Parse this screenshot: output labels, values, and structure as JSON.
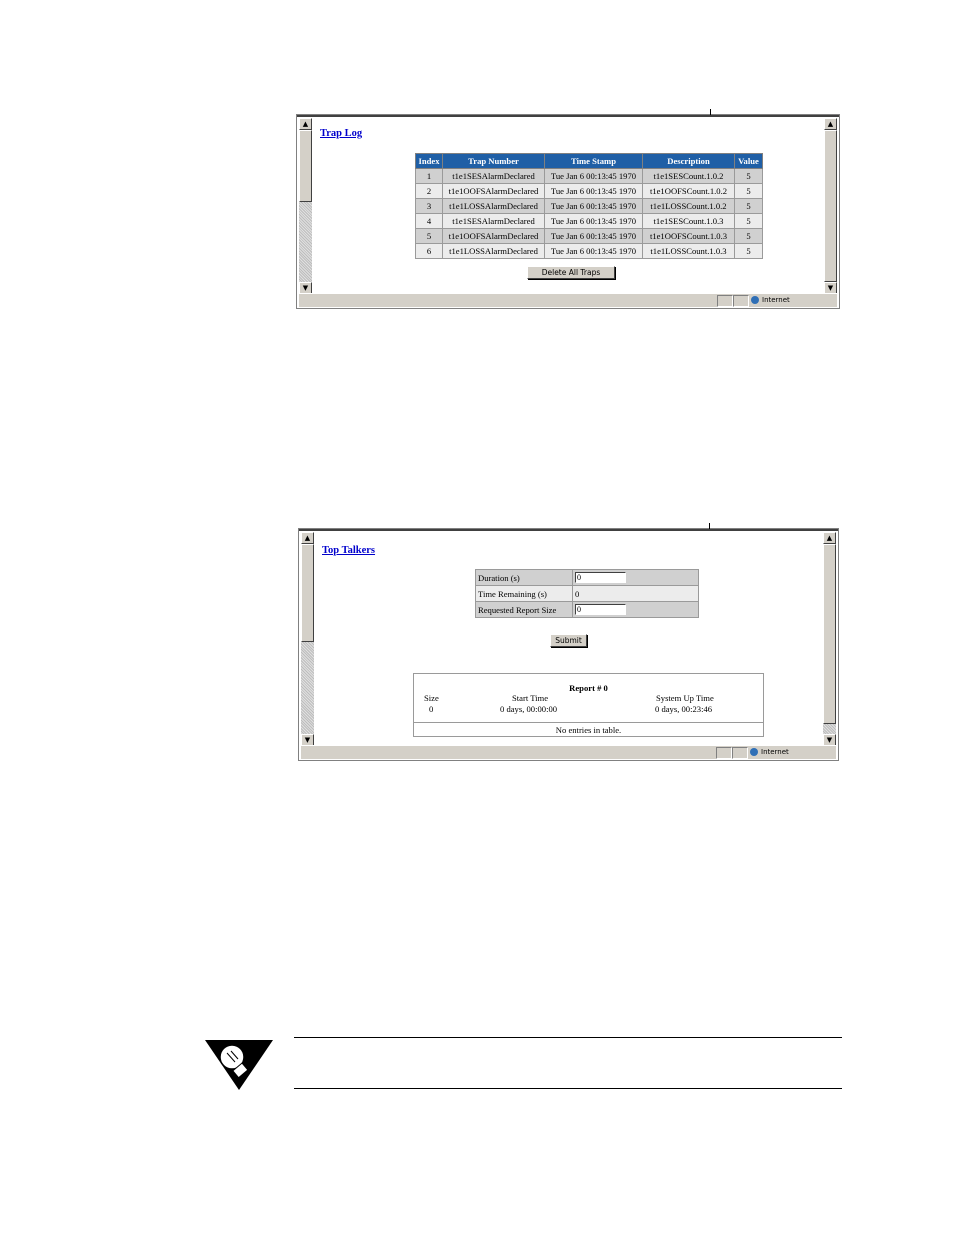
{
  "trap_log": {
    "title": "Trap Log",
    "columns": [
      "Index",
      "Trap Number",
      "Time Stamp",
      "Description",
      "Value"
    ],
    "rows": [
      [
        "1",
        "t1e1SESAlarmDeclared",
        "Tue Jan 6 00:13:45 1970",
        "t1e1SESCount.1.0.2",
        "5"
      ],
      [
        "2",
        "t1e1OOFSAlarmDeclared",
        "Tue Jan 6 00:13:45 1970",
        "t1e1OOFSCount.1.0.2",
        "5"
      ],
      [
        "3",
        "t1e1LOSSAlarmDeclared",
        "Tue Jan 6 00:13:45 1970",
        "t1e1LOSSCount.1.0.2",
        "5"
      ],
      [
        "4",
        "t1e1SESAlarmDeclared",
        "Tue Jan 6 00:13:45 1970",
        "t1e1SESCount.1.0.3",
        "5"
      ],
      [
        "5",
        "t1e1OOFSAlarmDeclared",
        "Tue Jan 6 00:13:45 1970",
        "t1e1OOFSCount.1.0.3",
        "5"
      ],
      [
        "6",
        "t1e1LOSSAlarmDeclared",
        "Tue Jan 6 00:13:45 1970",
        "t1e1LOSSCount.1.0.3",
        "5"
      ]
    ],
    "delete_button": "Delete All Traps",
    "status_zone": "Internet",
    "header_color": "#1f5fa6"
  },
  "top_talkers": {
    "title": "Top Talkers",
    "duration_label": "Duration (s)",
    "duration_value": "0",
    "time_remaining_label": "Time Remaining (s)",
    "time_remaining_value": "0",
    "report_size_label": "Requested Report Size",
    "report_size_value": "0",
    "submit_button": "Submit",
    "report": {
      "title": "Report # 0",
      "size_label": "Size",
      "size_value": "0",
      "start_label": "Start Time",
      "start_value": "0 days, 00:00:00",
      "uptime_label": "System Up Time",
      "uptime_value": "0 days, 00:23:46",
      "empty_text": "No entries in table."
    },
    "status_zone": "Internet"
  },
  "icons": {
    "tip": "lightbulb-icon",
    "zone": "globe-icon"
  }
}
